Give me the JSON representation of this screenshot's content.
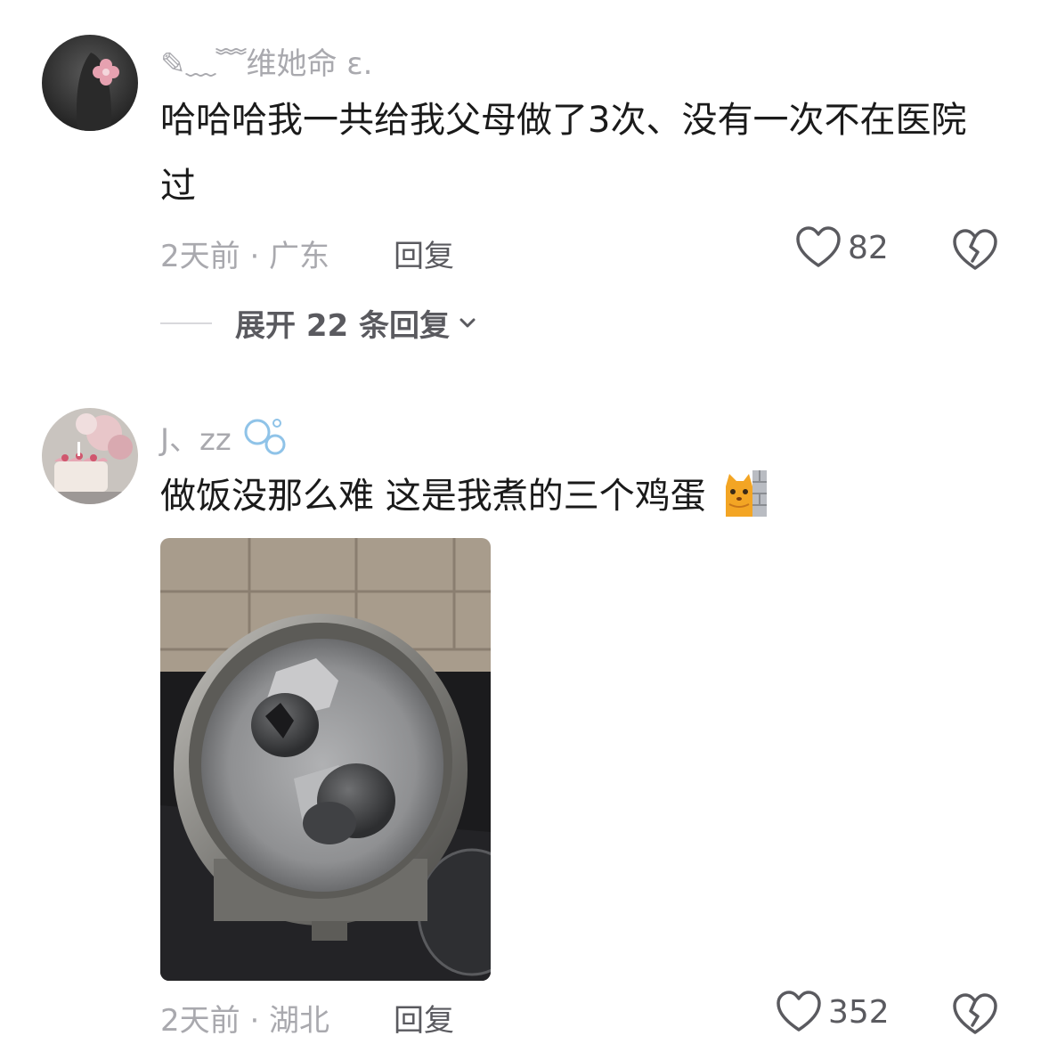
{
  "comments": [
    {
      "username": "✎﹏﹌维她命 ε.",
      "text": "哈哈哈我一共给我父母做了3次、没有一次不在医院过",
      "time_location": "2天前 · 广东",
      "reply_label": "回复",
      "likes": "82",
      "expand_label": "展开 22 条回复"
    },
    {
      "username": "J、zz",
      "username_emoji": "bubbles-emoji",
      "text": "做饭没那么难 这是我煮的三个鸡蛋",
      "text_emoji": "cat-peeking-emoji",
      "time_location": "2天前 · 湖北",
      "reply_label": "回复",
      "likes": "352",
      "image": "burnt-pot-with-eggs-photo"
    }
  ],
  "icons": {
    "like": "heart-outline-icon",
    "dislike": "broken-heart-icon",
    "expand": "chevron-down-icon"
  },
  "colors": {
    "text_primary": "#1a1a1a",
    "text_secondary": "#a9a9ae",
    "text_action": "#5a5a5f"
  }
}
